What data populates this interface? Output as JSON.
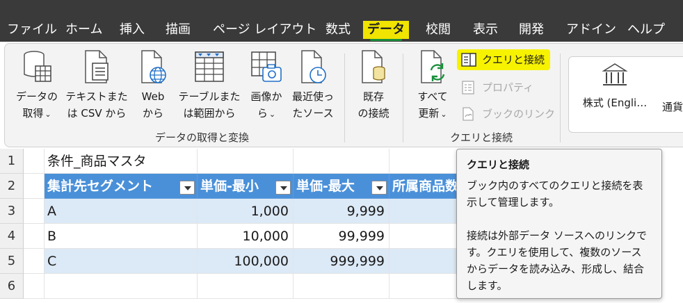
{
  "menu": {
    "tabs": [
      {
        "label": "ファイル"
      },
      {
        "label": "ホーム"
      },
      {
        "label": "挿入"
      },
      {
        "label": "描画"
      },
      {
        "label": "ページ レイアウト"
      },
      {
        "label": "数式"
      },
      {
        "label": "データ"
      },
      {
        "label": "校閲"
      },
      {
        "label": "表示"
      },
      {
        "label": "開発"
      },
      {
        "label": "アドイン"
      },
      {
        "label": "ヘルプ"
      }
    ],
    "active_tab": "データ"
  },
  "ribbon": {
    "get_transform": {
      "buttons": [
        {
          "line1": "データの",
          "line2": "取得"
        },
        {
          "line1": "テキストまた",
          "line2": "は CSV から"
        },
        {
          "line1": "Web",
          "line2": "から"
        },
        {
          "line1": "テーブルまた",
          "line2": "は範囲から"
        },
        {
          "line1": "画像か",
          "line2": "ら"
        },
        {
          "line1": "最近使っ",
          "line2": "たソース"
        },
        {
          "line1": "既存",
          "line2": "の接続"
        }
      ],
      "group_label": "データの取得と変換"
    },
    "queries": {
      "refresh_all": {
        "line1": "すべて",
        "line2": "更新"
      },
      "queries_connections": "クエリと接続",
      "properties": "プロパティ",
      "book_links": "ブックのリンク",
      "group_label": "クエリと接続"
    },
    "data_types": {
      "stocks": "株式 (Engli…",
      "currency": "通貨"
    }
  },
  "sheet": {
    "rows": [
      "1",
      "2",
      "3",
      "4",
      "5",
      "6"
    ],
    "a1": "条件_商品マスタ",
    "headers": [
      "集計先セグメント",
      "単価-最小",
      "単価-最大",
      "所属商品数"
    ],
    "data": [
      [
        "A",
        "1,000",
        "9,999"
      ],
      [
        "B",
        "10,000",
        "99,999"
      ],
      [
        "C",
        "100,000",
        "999,999"
      ]
    ]
  },
  "tooltip": {
    "title": "クエリと接続",
    "para1": "ブック内のすべてのクエリと接続を表示して管理します。",
    "para2": "接続は外部データ ソースへのリンクです。クエリを使用して、複数のソースからデータを読み込み、形成し、結合します。"
  },
  "colors": {
    "menubar_bg": "#3a3a3a",
    "highlight": "#f0e400",
    "table_header": "#4a90d9",
    "table_band": "#dce9f6"
  }
}
